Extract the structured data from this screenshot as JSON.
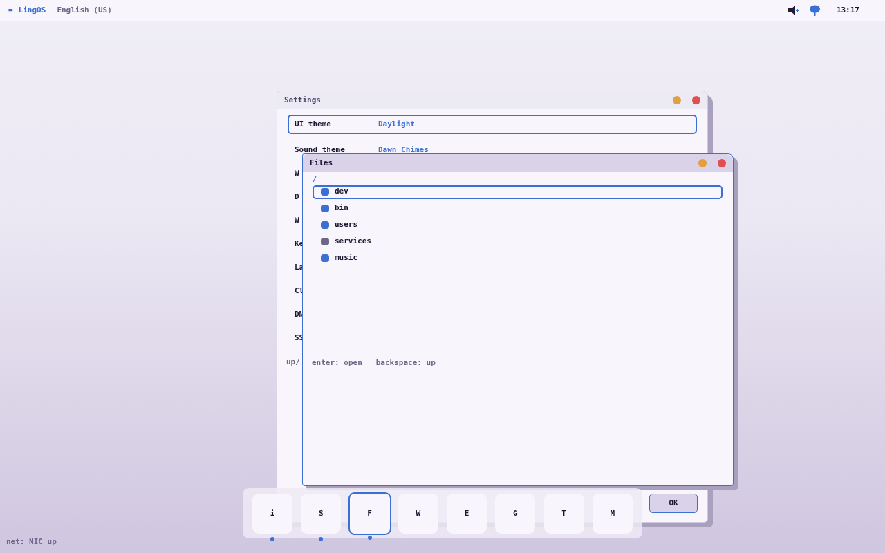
{
  "top_bar": {
    "menu_glyph": "=",
    "brand": "LingOS",
    "language": "English (US)",
    "clock": "13:17"
  },
  "settings_window": {
    "title": "Settings",
    "rows": [
      {
        "label": "UI theme",
        "value": "Daylight",
        "selected": true
      },
      {
        "label": "Sound theme",
        "value": "Dawn Chimes",
        "selected": false
      },
      {
        "label": "W",
        "selected": false
      },
      {
        "label": "D",
        "selected": false
      },
      {
        "label": "W",
        "selected": false
      },
      {
        "label": "Ke",
        "selected": false
      },
      {
        "label": "La",
        "selected": false
      },
      {
        "label": "Cl",
        "selected": false
      },
      {
        "label": "DN",
        "selected": false
      },
      {
        "label": "SS",
        "selected": false
      }
    ],
    "hint": "up/",
    "buttons": [
      "OK"
    ]
  },
  "files_window": {
    "title": "Files",
    "path": "/",
    "items": [
      {
        "name": "dev",
        "color": "#3a6fd4",
        "selected": true
      },
      {
        "name": "bin",
        "color": "#3a6fd4",
        "selected": false
      },
      {
        "name": "users",
        "color": "#3a6fd4",
        "selected": false
      },
      {
        "name": "services",
        "color": "#6e6688",
        "selected": false
      },
      {
        "name": "music",
        "color": "#3a6fd4",
        "selected": false
      }
    ],
    "hint": "enter: open   backspace: up"
  },
  "dock": [
    {
      "label": "i",
      "running": true,
      "selected": false
    },
    {
      "label": "S",
      "running": true,
      "selected": false
    },
    {
      "label": "F",
      "running": true,
      "selected": true
    },
    {
      "label": "W",
      "running": false,
      "selected": false
    },
    {
      "label": "E",
      "running": false,
      "selected": false
    },
    {
      "label": "G",
      "running": false,
      "selected": false
    },
    {
      "label": "T",
      "running": false,
      "selected": false
    },
    {
      "label": "M",
      "running": false,
      "selected": false
    }
  ],
  "status": "net: NIC up"
}
